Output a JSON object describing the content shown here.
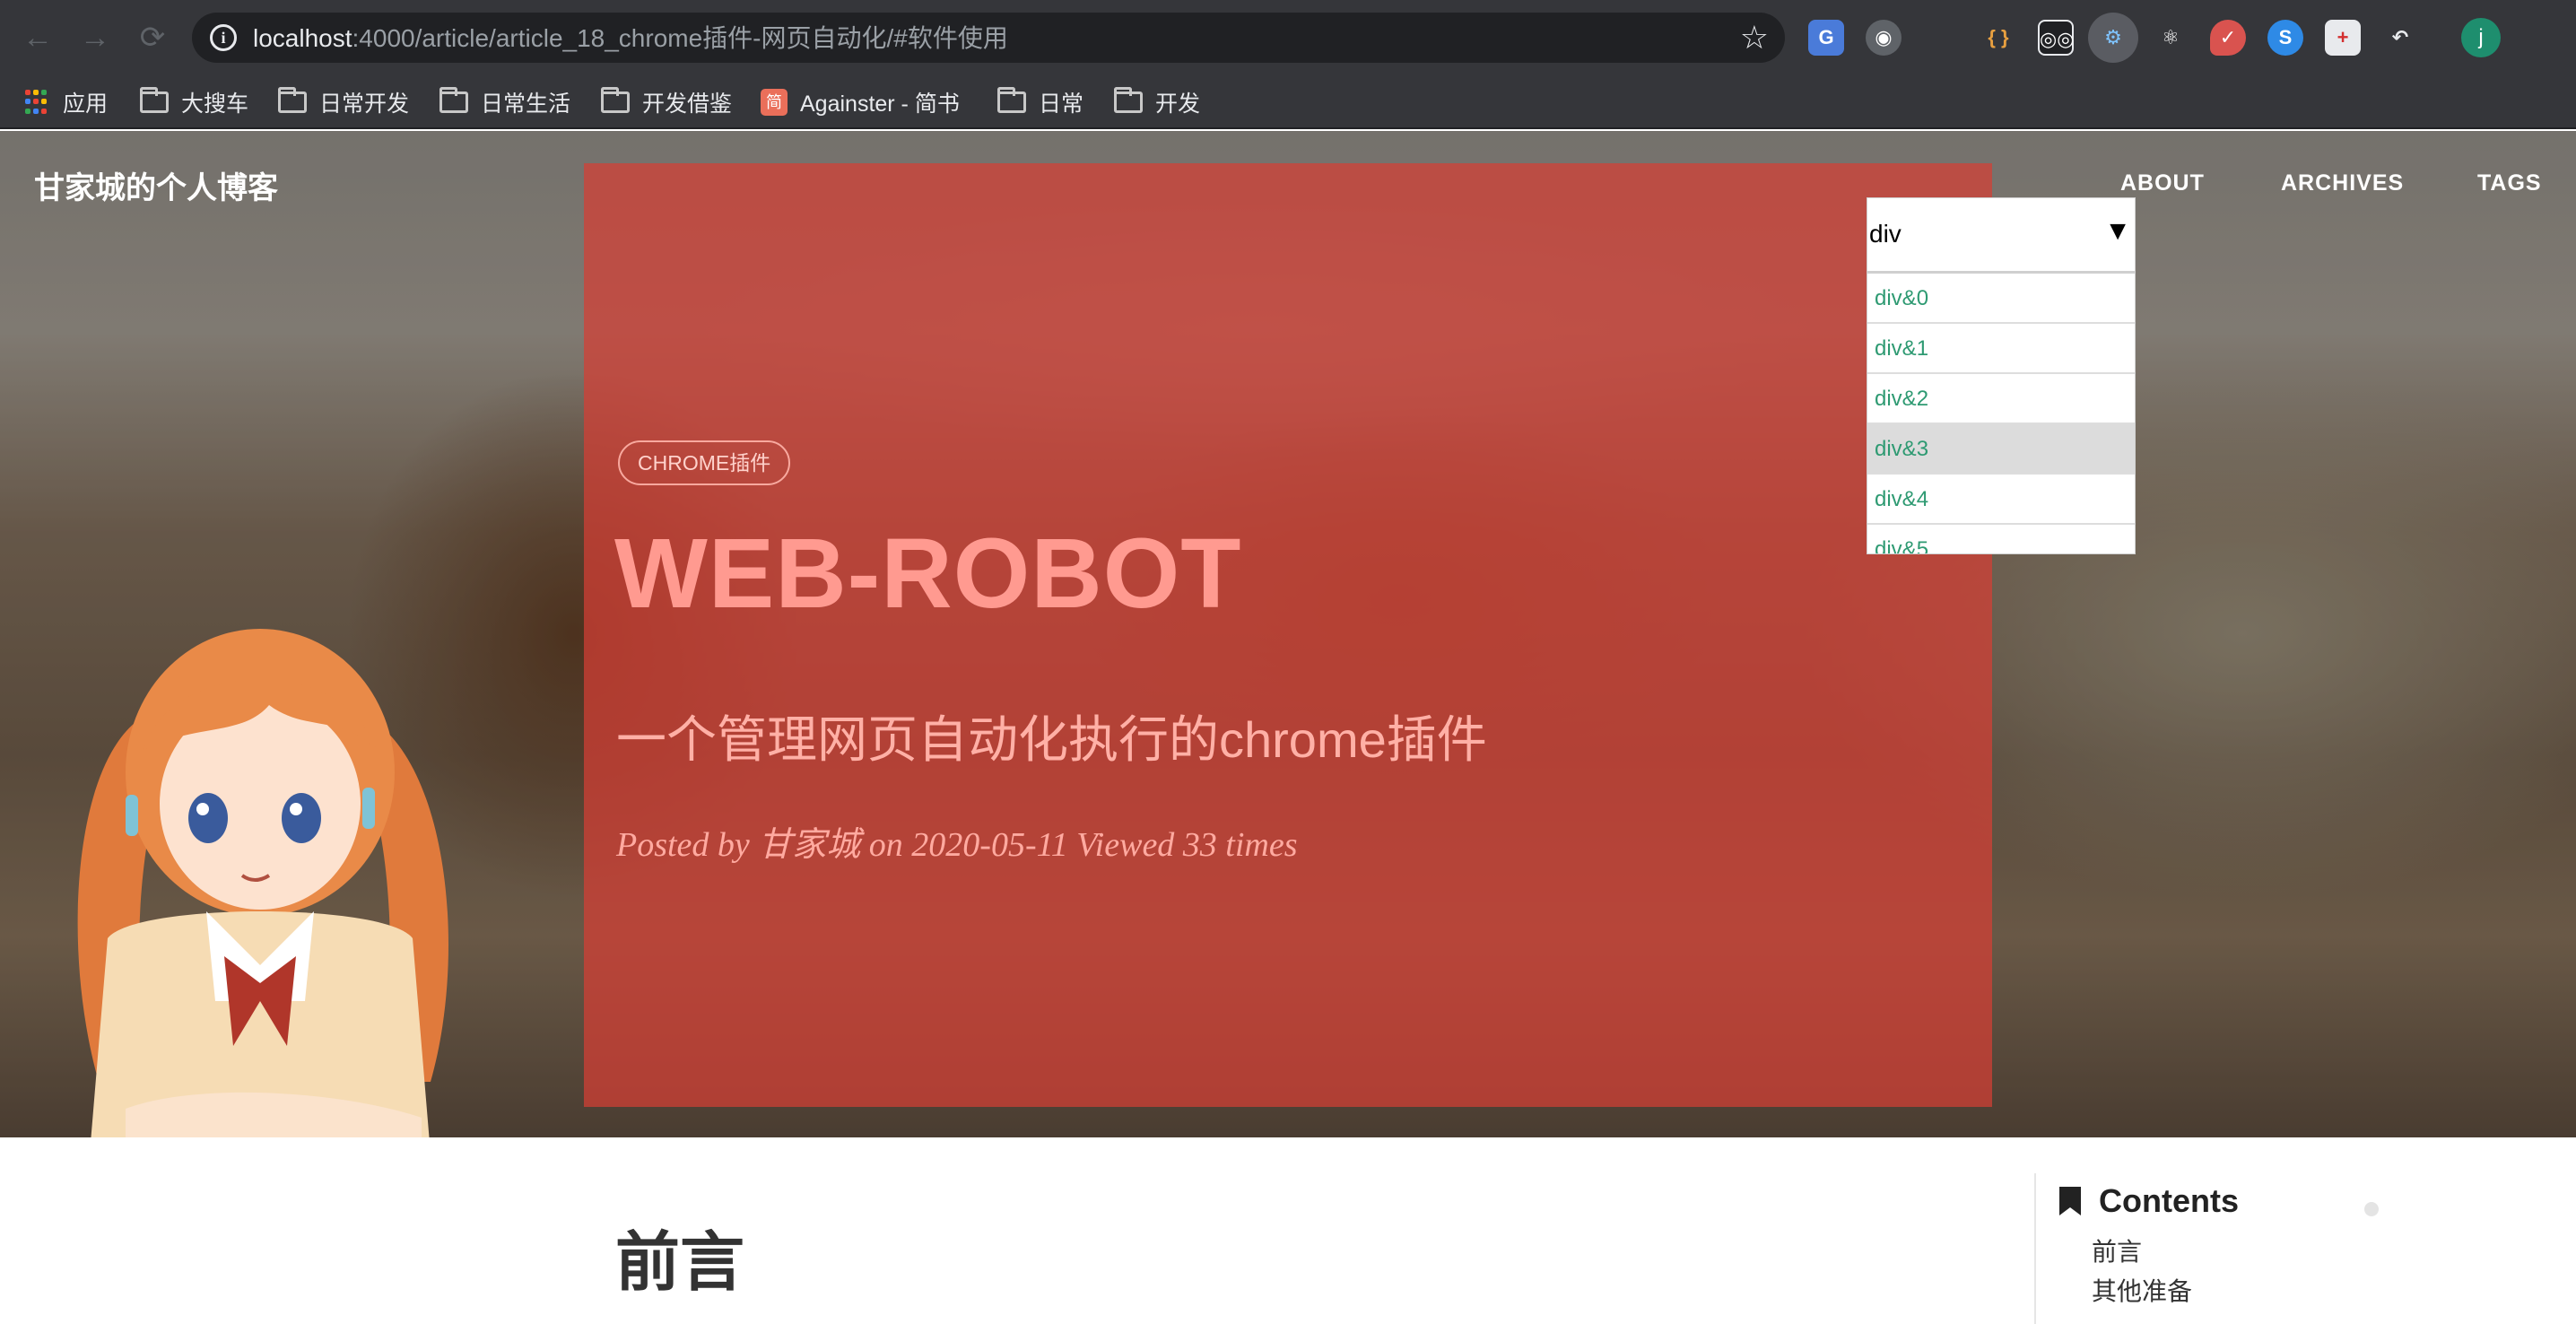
{
  "browser": {
    "url_host": "localhost",
    "url_rest": ":4000/article/article_18_chrome插件-网页自动化/#软件使用",
    "avatar_letter": "j",
    "bookmarks": [
      {
        "label": "应用",
        "icon": "apps-grid-icon"
      },
      {
        "label": "大搜车",
        "icon": "folder-icon"
      },
      {
        "label": "日常开发",
        "icon": "folder-icon"
      },
      {
        "label": "日常生活",
        "icon": "folder-icon"
      },
      {
        "label": "开发借鉴",
        "icon": "folder-icon"
      },
      {
        "label": "Againster - 简书",
        "icon": "jianshu-icon",
        "icon_text": "简"
      },
      {
        "label": "日常",
        "icon": "folder-icon"
      },
      {
        "label": "开发",
        "icon": "folder-icon"
      }
    ]
  },
  "site": {
    "title": "甘家城的个人博客",
    "nav": [
      "ABOUT",
      "ARCHIVES",
      "TAGS"
    ]
  },
  "post": {
    "tag": "CHROME插件",
    "title": "WEB-ROBOT",
    "subtitle": "一个管理网页自动化执行的chrome插件",
    "meta": "Posted by 甘家城 on 2020-05-11 Viewed 33 times"
  },
  "dropdown": {
    "selected": "div",
    "arrow": "▼",
    "options": [
      "div&0",
      "div&1",
      "div&2",
      "div&3",
      "div&4",
      "div&5"
    ],
    "highlighted_index": 3
  },
  "content": {
    "first_heading": "前言",
    "toc_title": "Contents",
    "toc_items": [
      "前言",
      "其他准备"
    ]
  },
  "colors": {
    "overlay": "#d63e34",
    "option_text": "#2e9a72",
    "toolbar": "#35363a"
  }
}
